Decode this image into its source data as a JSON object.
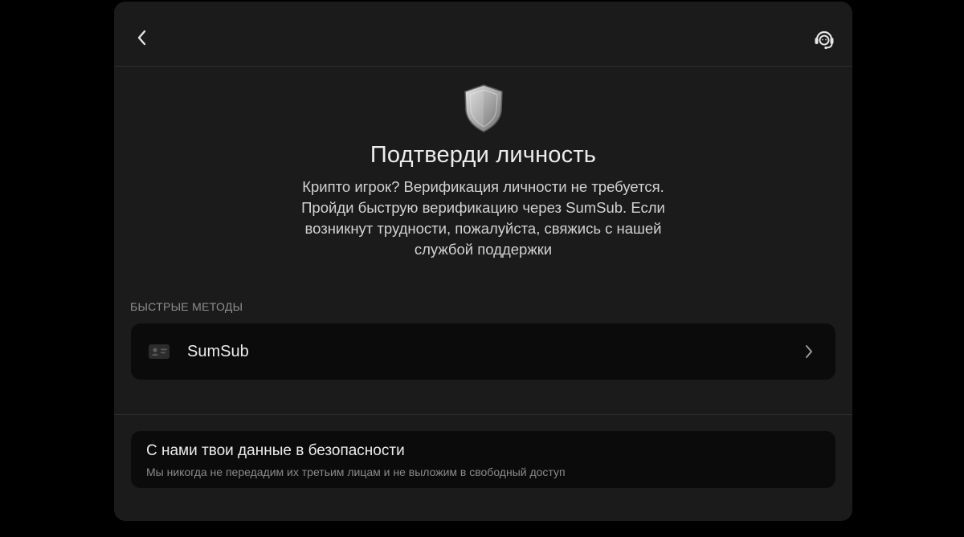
{
  "header": {
    "back_icon": "chevron-left-icon",
    "support_icon": "headset-support-icon"
  },
  "hero": {
    "icon": "shield-icon",
    "title": "Подтверди личность",
    "description": "Крипто игрок? Верификация личности не требуется. Пройди быструю верификацию через SumSub. Если возникнут трудности, пожалуйста, свяжись с нашей службой поддержки"
  },
  "methods": {
    "section_label": "БЫСТРЫЕ МЕТОДЫ",
    "items": [
      {
        "label": "SumSub",
        "icon": "id-card-icon",
        "action_icon": "chevron-right-icon"
      }
    ]
  },
  "safety": {
    "title": "С нами твои данные в безопасности",
    "subtitle": "Мы никогда не передадим их третьим лицам и не выложим в свободный доступ"
  },
  "colors": {
    "background": "#000000",
    "modal": "#1b1b1c",
    "card": "#0b0b0b",
    "text_primary": "#ececec",
    "text_secondary": "#8e8e92"
  }
}
